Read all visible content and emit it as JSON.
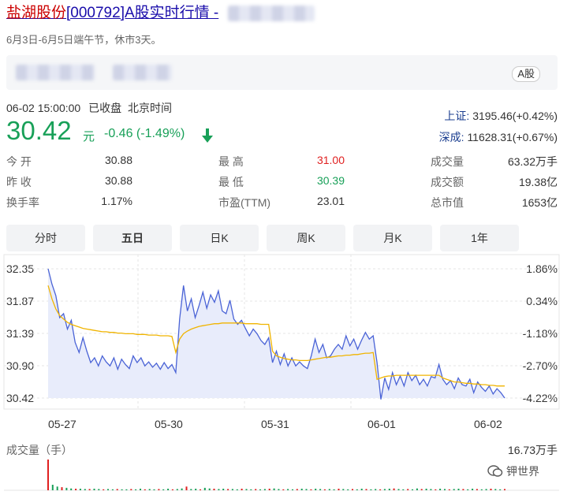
{
  "header": {
    "title_name": "盐湖股份",
    "title_rest": "[000792]A股实时行情 -",
    "subtitle": "6月3日-6月5日端午节，休市3天。"
  },
  "market_tag": "A股",
  "quote": {
    "datetime": "06-02 15:00:00",
    "status": "已收盘",
    "timezone": "北京时间",
    "price": "30.42",
    "unit": "元",
    "change": "-0.46 (-1.49%)"
  },
  "indices": [
    {
      "name": "上证:",
      "value": "3195.46(+0.42%)"
    },
    {
      "name": "深成:",
      "value": "11628.31(+0.67%)"
    }
  ],
  "stats": [
    {
      "label": "今 开",
      "value": "30.88",
      "color": "default"
    },
    {
      "label": "昨 收",
      "value": "30.88",
      "color": "default"
    },
    {
      "label": "换手率",
      "value": "1.17%",
      "color": "default"
    },
    {
      "label": "最 高",
      "value": "31.00",
      "color": "red"
    },
    {
      "label": "最 低",
      "value": "30.39",
      "color": "green"
    },
    {
      "label": "市盈(TTM)",
      "value": "23.01",
      "color": "default"
    },
    {
      "label": "成交量",
      "value": "63.32万手",
      "color": "default"
    },
    {
      "label": "成交额",
      "value": "19.38亿",
      "color": "default"
    },
    {
      "label": "总市值",
      "value": "1653亿",
      "color": "default"
    }
  ],
  "tabs": [
    {
      "label": "分时",
      "active": false
    },
    {
      "label": "五日",
      "active": true
    },
    {
      "label": "日K",
      "active": false
    },
    {
      "label": "周K",
      "active": false
    },
    {
      "label": "月K",
      "active": false
    },
    {
      "label": "1年",
      "active": false
    }
  ],
  "chart_data": {
    "type": "line",
    "ylim": [
      30.42,
      32.35
    ],
    "y_ticks": [
      "32.35",
      "31.87",
      "31.39",
      "30.90",
      "30.42"
    ],
    "y_right_ticks": [
      "1.86%",
      "0.34%",
      "-1.18%",
      "-2.70%",
      "-4.22%"
    ],
    "x_ticks": [
      "05-27",
      "05-30",
      "05-31",
      "06-01",
      "06-02"
    ],
    "colors": {
      "price": "#4a63d6",
      "avg": "#f0b400",
      "fill": "#e8ecfb",
      "grid": "#e6e6e6"
    },
    "series": [
      {
        "values": [
          32.35,
          32.12,
          31.95,
          31.62,
          31.68,
          31.45,
          31.58,
          31.25,
          31.1,
          31.32,
          31.12,
          30.95,
          31.02,
          30.9,
          31.05,
          30.96,
          30.9,
          31.02,
          30.85,
          31.0,
          30.92,
          30.86,
          31.05,
          30.95,
          31.02,
          30.9,
          30.96,
          30.88,
          30.94,
          30.85,
          30.95,
          30.86,
          30.92,
          30.8,
          31.6,
          32.1,
          31.72,
          31.9,
          31.62,
          31.8,
          32.0,
          31.76,
          31.96,
          31.85,
          32.02,
          31.72,
          31.68,
          31.88,
          31.6,
          31.52,
          31.58,
          31.46,
          31.35,
          31.45,
          31.38,
          31.28,
          31.22,
          31.32,
          30.95,
          31.12,
          30.92,
          31.08,
          30.9,
          31.02,
          30.9,
          30.96,
          30.9,
          30.86,
          31.05,
          31.3,
          31.1,
          31.22,
          31.02,
          31.05,
          31.15,
          31.22,
          31.15,
          31.35,
          31.2,
          31.3,
          31.15,
          31.28,
          31.4,
          31.3,
          31.35,
          30.95,
          30.4,
          30.72,
          30.55,
          30.8,
          30.62,
          30.75,
          30.6,
          30.8,
          30.68,
          30.76,
          30.62,
          30.7,
          30.6,
          30.74,
          30.72,
          30.92,
          30.7,
          30.62,
          30.68,
          30.56,
          30.72,
          30.62,
          30.6,
          30.7,
          30.5,
          30.66,
          30.58,
          30.52,
          30.6,
          30.48,
          30.56,
          30.5,
          30.42
        ]
      },
      {
        "values": [
          32.1,
          31.9,
          31.75,
          31.65,
          31.6,
          31.55,
          31.52,
          31.5,
          31.48,
          31.46,
          31.45,
          31.44,
          31.43,
          31.42,
          31.41,
          31.41,
          31.4,
          31.4,
          31.39,
          31.39,
          31.38,
          31.38,
          31.38,
          31.37,
          31.37,
          31.37,
          31.36,
          31.36,
          31.36,
          31.35,
          31.35,
          31.35,
          31.34,
          31.1,
          31.3,
          31.38,
          31.42,
          31.45,
          31.47,
          31.49,
          31.5,
          31.51,
          31.52,
          31.53,
          31.53,
          31.54,
          31.54,
          31.54,
          31.54,
          31.54,
          31.54,
          31.53,
          31.53,
          31.53,
          31.53,
          31.52,
          31.52,
          31.52,
          31.12,
          31.05,
          31.03,
          31.01,
          31.0,
          30.99,
          30.99,
          30.98,
          30.98,
          30.98,
          30.99,
          31.0,
          31.01,
          31.02,
          31.03,
          31.03,
          31.04,
          31.05,
          31.05,
          31.06,
          31.06,
          31.07,
          31.07,
          31.08,
          31.09,
          31.09,
          31.1,
          30.7,
          30.72,
          30.74,
          30.75,
          30.75,
          30.76,
          30.76,
          30.76,
          30.76,
          30.76,
          30.76,
          30.76,
          30.76,
          30.76,
          30.76,
          30.76,
          30.76,
          30.72,
          30.7,
          30.68,
          30.66,
          30.66,
          30.65,
          30.64,
          30.64,
          30.63,
          30.63,
          30.62,
          30.62,
          30.61,
          30.61,
          30.6,
          30.6,
          30.6
        ]
      }
    ]
  },
  "volume": {
    "title": "成交量（手）",
    "max": "16.73万手",
    "bars": [
      1.0,
      0.18,
      0.12,
      0.1,
      0.08,
      0.06,
      0.05,
      0.05,
      0.04,
      0.04,
      0.05,
      0.04,
      0.03,
      0.04,
      0.03,
      0.04,
      0.03,
      0.03,
      0.04,
      0.03,
      0.05,
      0.03,
      0.04,
      0.03,
      0.04,
      0.03,
      0.05,
      0.03,
      0.04,
      0.06,
      0.12,
      0.04,
      0.05,
      0.03,
      0.08,
      0.06,
      0.05,
      0.04,
      0.05,
      0.04,
      0.04,
      0.03,
      0.05,
      0.04,
      0.03,
      0.04,
      0.03,
      0.04,
      0.05,
      0.06,
      0.04,
      0.03,
      0.04,
      0.03,
      0.04,
      0.05,
      0.04,
      0.03,
      0.05,
      0.04,
      0.03,
      0.04,
      0.03,
      0.05,
      0.04,
      0.03,
      0.04,
      0.03,
      0.05,
      0.04,
      0.03,
      0.04,
      0.03,
      0.04,
      0.05,
      0.06,
      0.04,
      0.03,
      0.04,
      0.03,
      0.06,
      0.04,
      0.05,
      0.04,
      0.03,
      0.05,
      0.04,
      0.03,
      0.04,
      0.05,
      0.04,
      0.03,
      0.05,
      0.04,
      0.03,
      0.04,
      0.05,
      0.04,
      0.03,
      0.04
    ]
  },
  "watermark": "钾世界"
}
